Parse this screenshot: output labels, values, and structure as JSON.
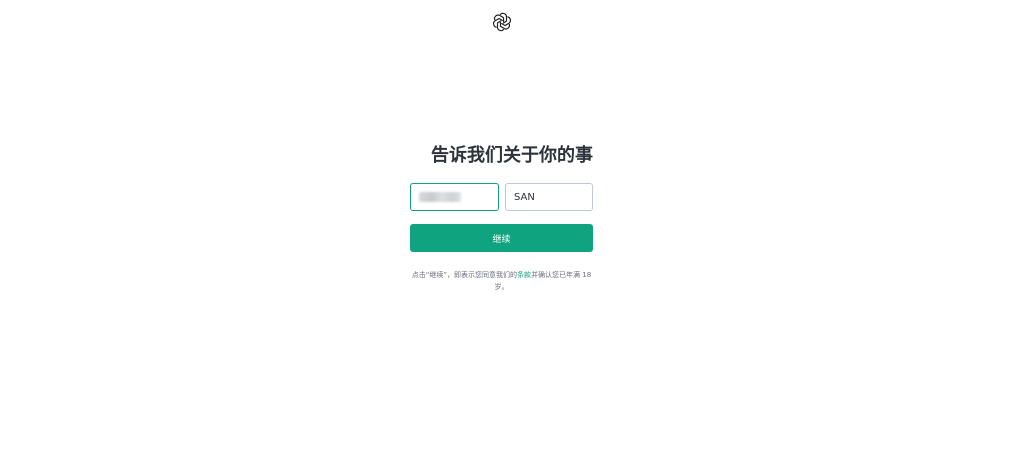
{
  "brand": {
    "logo_icon": "openai-logo-icon",
    "accent_color": "#10a37f"
  },
  "heading": "告诉我们关于你的事",
  "form": {
    "first_name": {
      "value": "",
      "value_obscured": true
    },
    "last_name": {
      "value": "SAN"
    },
    "continue_label": "继续"
  },
  "terms": {
    "prefix": "点击“继续”，即表示您同意我们的",
    "link_label": "条款",
    "suffix": "并确认您已年满 18 岁。"
  }
}
